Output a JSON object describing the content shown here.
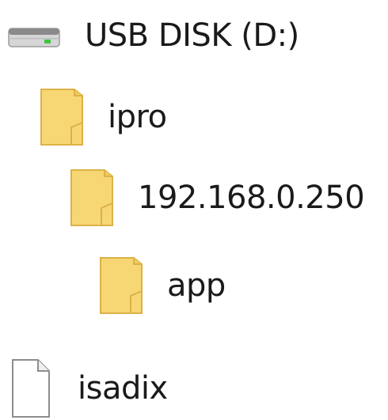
{
  "tree": {
    "drive": {
      "label": "USB DISK (D:)",
      "icon": "usb-drive-icon"
    },
    "folders": [
      {
        "label": "ipro",
        "icon": "folder-icon"
      },
      {
        "label": "192.168.0.250",
        "icon": "folder-icon"
      },
      {
        "label": "app",
        "icon": "folder-icon"
      }
    ],
    "file": {
      "label": "isadix",
      "icon": "file-icon"
    }
  },
  "colors": {
    "folder_fill": "#f7d774",
    "folder_edge": "#dcb148",
    "drive_body": "#d6d6d6",
    "drive_top": "#8a8a8a",
    "drive_led": "#3ec63e",
    "text": "#1a1a1a"
  }
}
